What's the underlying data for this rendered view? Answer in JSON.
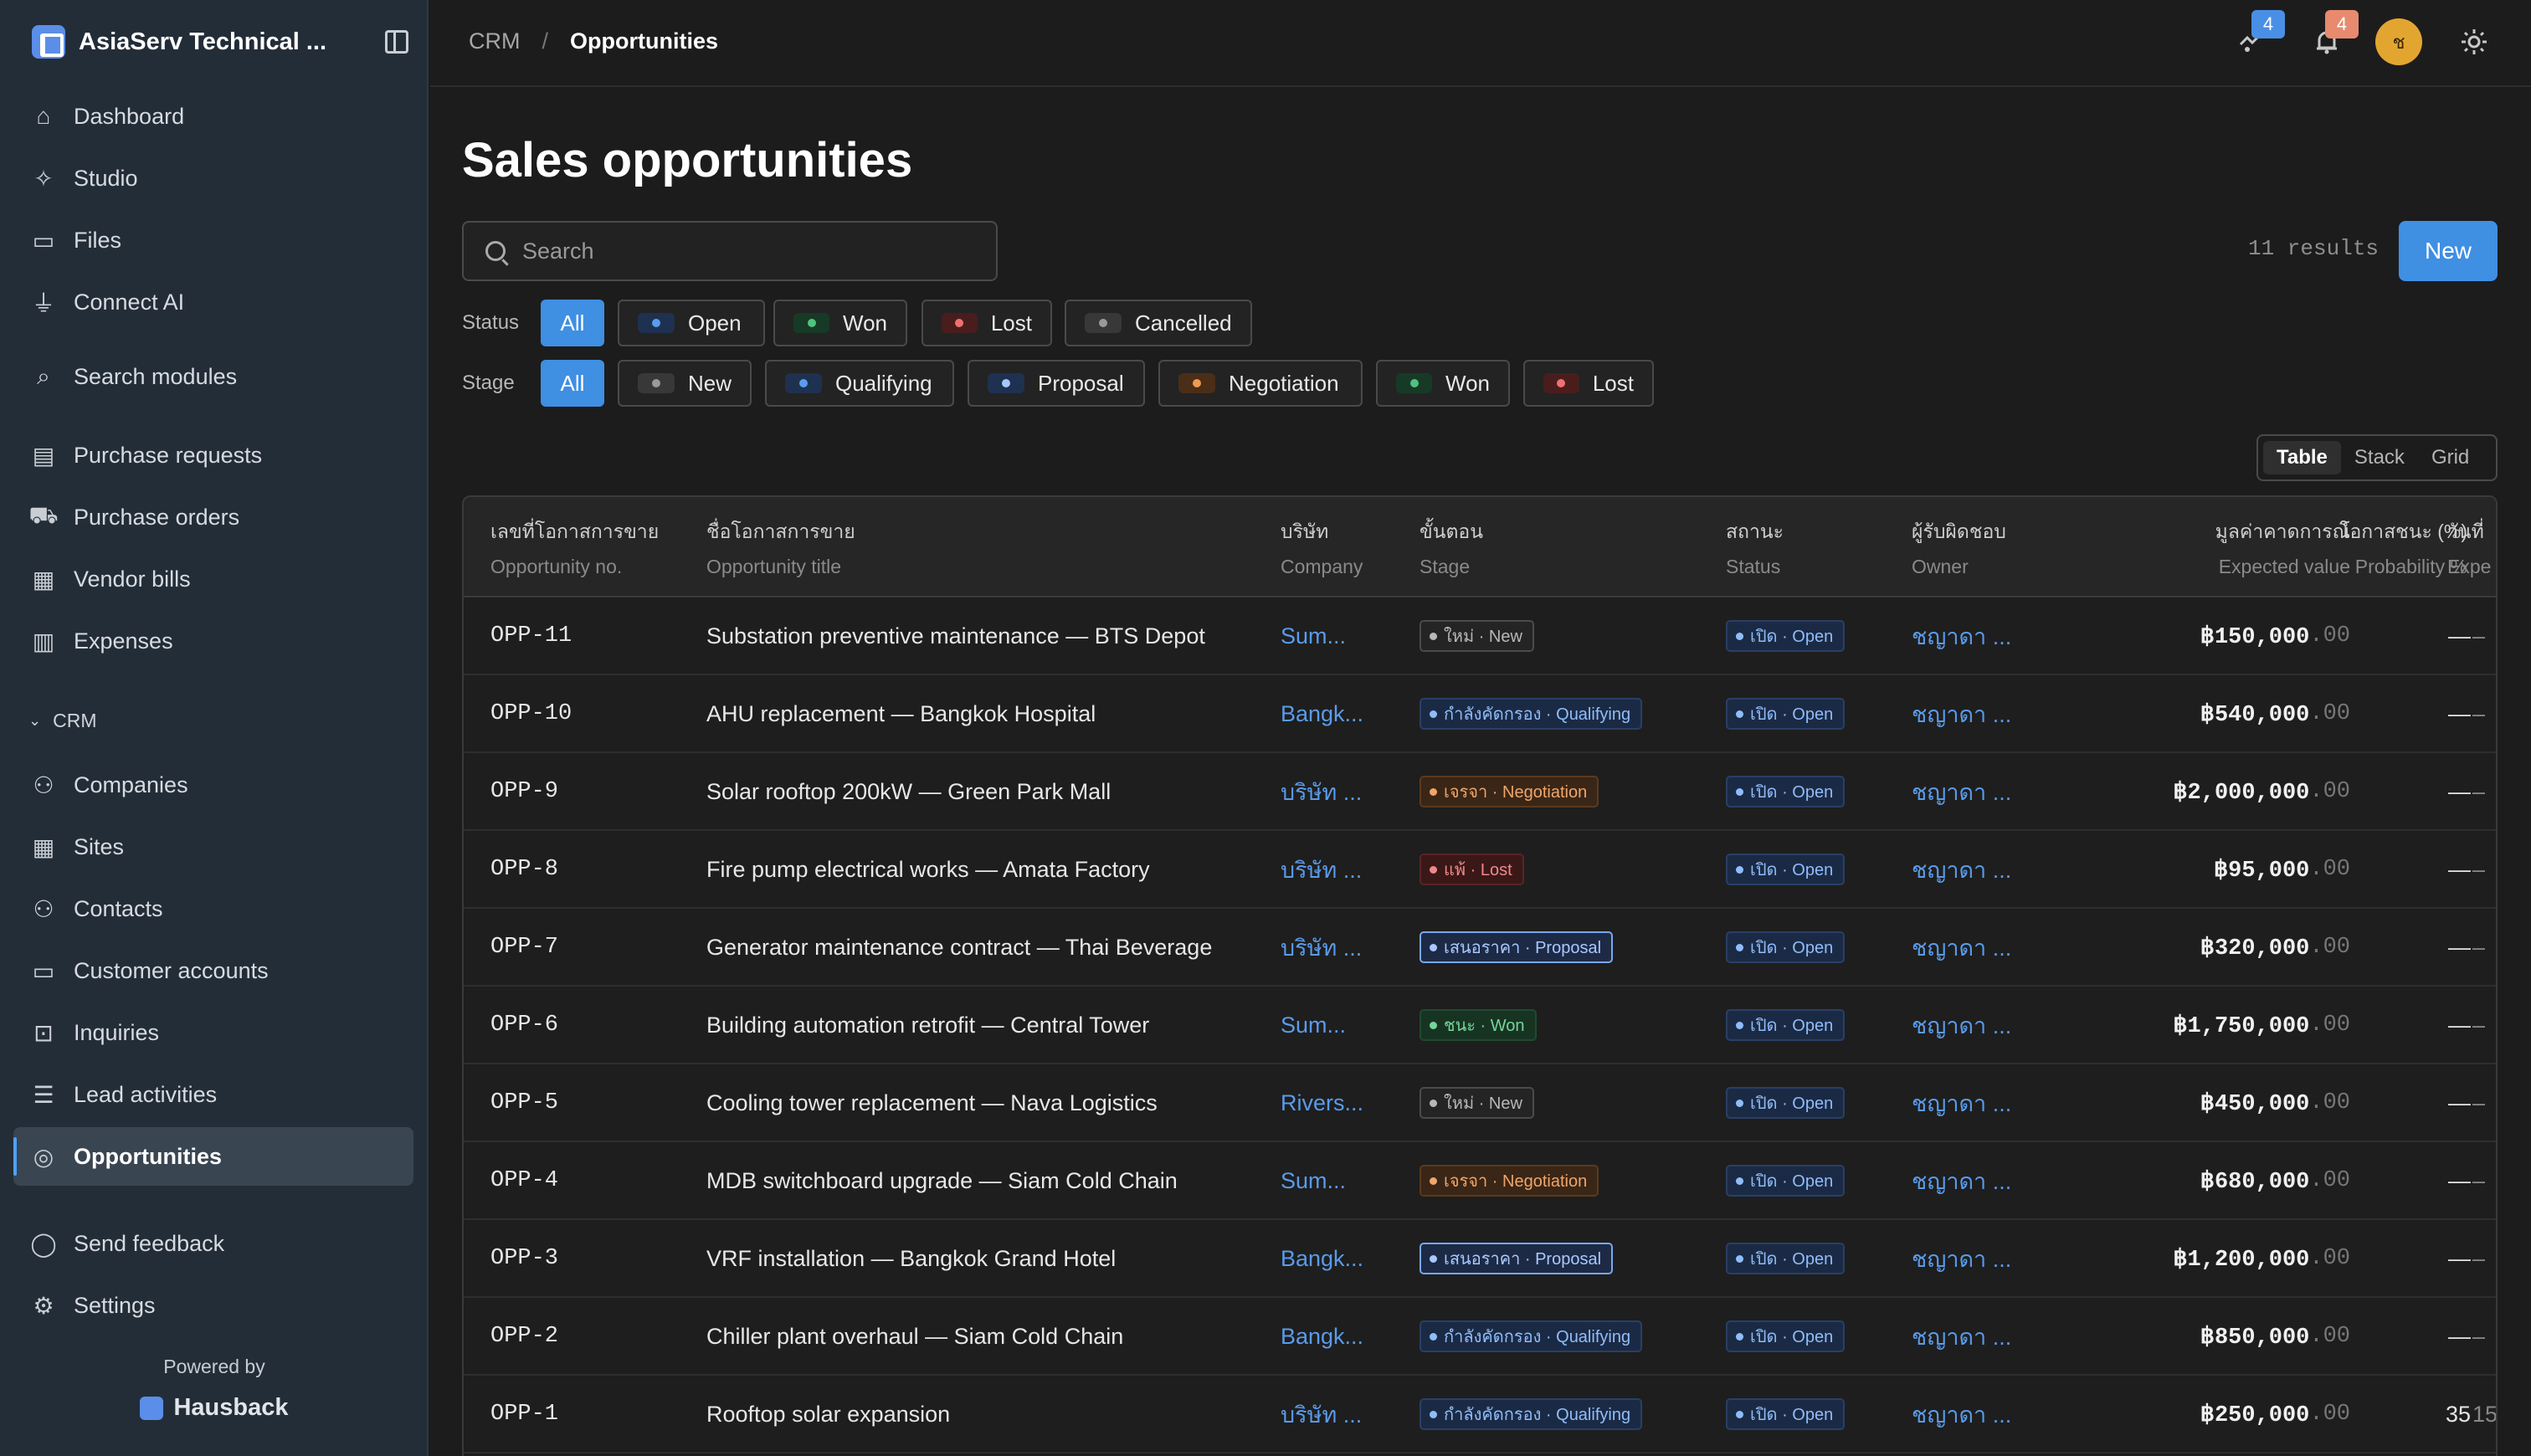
{
  "app": {
    "name": "AsiaServ Technical ...",
    "powered_by": "Powered by",
    "powered_brand": "Hausback"
  },
  "sidebar": {
    "items": [
      {
        "label": "Dashboard",
        "icon": "home-icon"
      },
      {
        "label": "Studio",
        "icon": "sparkle-icon"
      },
      {
        "label": "Files",
        "icon": "folder-icon"
      },
      {
        "label": "Connect AI",
        "icon": "plug-icon"
      },
      {
        "label": "Search modules",
        "icon": "search-icon"
      },
      {
        "label": "Purchase requests",
        "icon": "clipboard-icon"
      },
      {
        "label": "Purchase orders",
        "icon": "cart-icon"
      },
      {
        "label": "Vendor bills",
        "icon": "bill-icon"
      },
      {
        "label": "Expenses",
        "icon": "receipt-icon"
      }
    ],
    "crm_label": "CRM",
    "crm_items": [
      {
        "label": "Companies",
        "icon": "users-icon"
      },
      {
        "label": "Sites",
        "icon": "building-icon"
      },
      {
        "label": "Contacts",
        "icon": "contacts-icon"
      },
      {
        "label": "Customer accounts",
        "icon": "wallet-icon"
      },
      {
        "label": "Inquiries",
        "icon": "inbox-icon"
      },
      {
        "label": "Lead activities",
        "icon": "list-check-icon"
      },
      {
        "label": "Opportunities",
        "icon": "target-icon",
        "active": true
      }
    ],
    "footer_items": [
      {
        "label": "Send feedback",
        "icon": "chat-icon"
      },
      {
        "label": "Settings",
        "icon": "gear-icon"
      }
    ]
  },
  "topbar": {
    "breadcrumb": [
      "CRM",
      "Opportunities"
    ],
    "activity_badge": "4",
    "notification_badge": "4",
    "avatar_initial": "ช"
  },
  "page": {
    "title": "Sales opportunities",
    "search_placeholder": "Search",
    "results": "11 results",
    "new_label": "New"
  },
  "filters": {
    "status_label": "Status",
    "status_chips": [
      {
        "label": "All",
        "active": true
      },
      {
        "label": "Open",
        "dot": "#5b9cf0",
        "bg": "#1e3150"
      },
      {
        "label": "Won",
        "dot": "#4fc27d",
        "bg": "#173a26"
      },
      {
        "label": "Lost",
        "dot": "#f07070",
        "bg": "#4a1d1d"
      },
      {
        "label": "Cancelled",
        "dot": "#9a9a9a",
        "bg": "#383838"
      }
    ],
    "stage_label": "Stage",
    "stage_chips": [
      {
        "label": "All",
        "active": true
      },
      {
        "label": "New",
        "dot": "#9a9a9a",
        "bg": "#383838"
      },
      {
        "label": "Qualifying",
        "dot": "#5b9cf0",
        "bg": "#1e3150"
      },
      {
        "label": "Proposal",
        "dot": "#a8c6ff",
        "bg": "#1e3150"
      },
      {
        "label": "Negotiation",
        "dot": "#f09a50",
        "bg": "#4a2e17"
      },
      {
        "label": "Won",
        "dot": "#4fc27d",
        "bg": "#173a26"
      },
      {
        "label": "Lost",
        "dot": "#f07070",
        "bg": "#4a1d1d"
      }
    ]
  },
  "view_toggle": [
    "Table",
    "Stack",
    "Grid"
  ],
  "table": {
    "headers": [
      {
        "thai": "เลขที่โอกาสการขาย",
        "eng": "Opportunity no."
      },
      {
        "thai": "ชื่อโอกาสการขาย",
        "eng": "Opportunity title"
      },
      {
        "thai": "บริษัท",
        "eng": "Company"
      },
      {
        "thai": "ขั้นตอน",
        "eng": "Stage"
      },
      {
        "thai": "สถานะ",
        "eng": "Status"
      },
      {
        "thai": "ผู้รับผิดชอบ",
        "eng": "Owner"
      },
      {
        "thai": "มูลค่าคาดการณ์",
        "eng": "Expected value"
      },
      {
        "thai": "โอกาสชนะ (%)",
        "eng": "Probability %"
      },
      {
        "thai": "วันที่",
        "eng": "Expe"
      }
    ],
    "rows": [
      {
        "no": "OPP-11",
        "title": "Substation preventive maintenance — BTS Depot",
        "company": "Sum...",
        "stage": "ใหม่ · New",
        "stage_kind": "new",
        "status": "เปิด · Open",
        "owner": "ชญาดา ...",
        "value": "฿150,000",
        "dec": ".00",
        "prob": "—",
        "exp": "–"
      },
      {
        "no": "OPP-10",
        "title": "AHU replacement — Bangkok Hospital",
        "company": "Bangk...",
        "stage": "กำลังคัดกรอง · Qualifying",
        "stage_kind": "qual",
        "status": "เปิด · Open",
        "owner": "ชญาดา ...",
        "value": "฿540,000",
        "dec": ".00",
        "prob": "—",
        "exp": "–"
      },
      {
        "no": "OPP-9",
        "title": "Solar rooftop 200kW — Green Park Mall",
        "company": "บริษัท ...",
        "stage": "เจรจา · Negotiation",
        "stage_kind": "nego",
        "status": "เปิด · Open",
        "owner": "ชญาดา ...",
        "value": "฿2,000,000",
        "dec": ".00",
        "prob": "—",
        "exp": "–"
      },
      {
        "no": "OPP-8",
        "title": "Fire pump electrical works — Amata Factory",
        "company": "บริษัท ...",
        "stage": "แพ้ · Lost",
        "stage_kind": "lost",
        "status": "เปิด · Open",
        "owner": "ชญาดา ...",
        "value": "฿95,000",
        "dec": ".00",
        "prob": "—",
        "exp": "–"
      },
      {
        "no": "OPP-7",
        "title": "Generator maintenance contract — Thai Beverage",
        "company": "บริษัท ...",
        "stage": "เสนอราคา · Proposal",
        "stage_kind": "prop",
        "status": "เปิด · Open",
        "owner": "ชญาดา ...",
        "value": "฿320,000",
        "dec": ".00",
        "prob": "—",
        "exp": "–"
      },
      {
        "no": "OPP-6",
        "title": "Building automation retrofit — Central Tower",
        "company": "Sum...",
        "stage": "ชนะ · Won",
        "stage_kind": "won",
        "status": "เปิด · Open",
        "owner": "ชญาดา ...",
        "value": "฿1,750,000",
        "dec": ".00",
        "prob": "—",
        "exp": "–"
      },
      {
        "no": "OPP-5",
        "title": "Cooling tower replacement — Nava Logistics",
        "company": "Rivers...",
        "stage": "ใหม่ · New",
        "stage_kind": "new",
        "status": "เปิด · Open",
        "owner": "ชญาดา ...",
        "value": "฿450,000",
        "dec": ".00",
        "prob": "—",
        "exp": "–"
      },
      {
        "no": "OPP-4",
        "title": "MDB switchboard upgrade — Siam Cold Chain",
        "company": "Sum...",
        "stage": "เจรจา · Negotiation",
        "stage_kind": "nego",
        "status": "เปิด · Open",
        "owner": "ชญาดา ...",
        "value": "฿680,000",
        "dec": ".00",
        "prob": "—",
        "exp": "–"
      },
      {
        "no": "OPP-3",
        "title": "VRF installation — Bangkok Grand Hotel",
        "company": "Bangk...",
        "stage": "เสนอราคา · Proposal",
        "stage_kind": "prop",
        "status": "เปิด · Open",
        "owner": "ชญาดา ...",
        "value": "฿1,200,000",
        "dec": ".00",
        "prob": "—",
        "exp": "–"
      },
      {
        "no": "OPP-2",
        "title": "Chiller plant overhaul — Siam Cold Chain",
        "company": "Bangk...",
        "stage": "กำลังคัดกรอง · Qualifying",
        "stage_kind": "qual",
        "status": "เปิด · Open",
        "owner": "ชญาดา ...",
        "value": "฿850,000",
        "dec": ".00",
        "prob": "—",
        "exp": "–"
      },
      {
        "no": "OPP-1",
        "title": "Rooftop solar expansion",
        "company": "บริษัท ...",
        "stage": "กำลังคัดกรอง · Qualifying",
        "stage_kind": "qual",
        "status": "เปิด · Open",
        "owner": "ชญาดา ...",
        "value": "฿250,000",
        "dec": ".00",
        "prob": "35",
        "exp": "15"
      }
    ]
  }
}
